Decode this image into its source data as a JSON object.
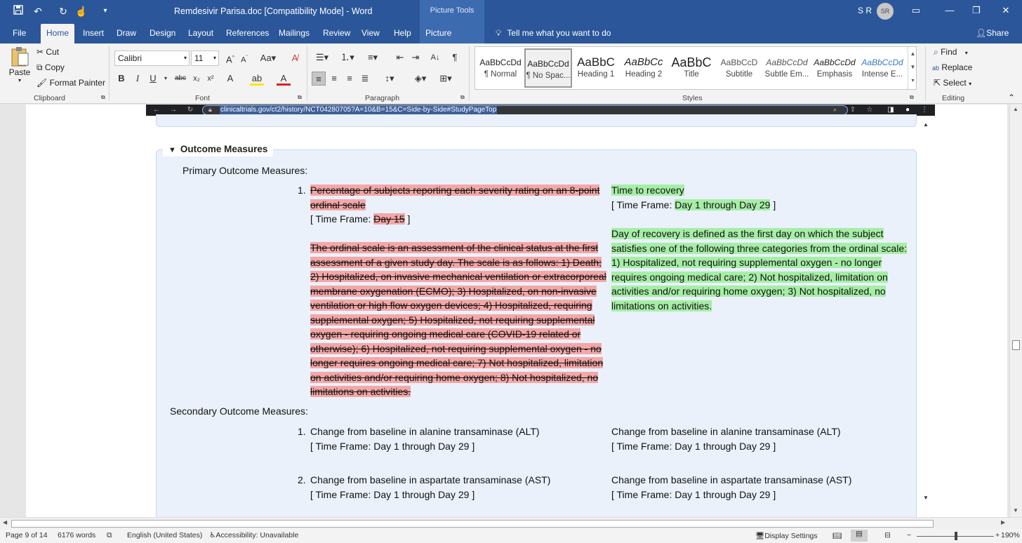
{
  "titlebar": {
    "doc_title": "Remdesivir Parisa.doc  [Compatibility Mode]  -  Word",
    "picture_tools": "Picture Tools",
    "user_initials": "S R",
    "avatar": "SR"
  },
  "tabs": [
    "File",
    "Home",
    "Insert",
    "Draw",
    "Design",
    "Layout",
    "References",
    "Mailings",
    "Review",
    "View",
    "Help",
    "Picture Format"
  ],
  "tell_me": "Tell me what you want to do",
  "share": "Share",
  "clipboard": {
    "paste": "Paste",
    "cut": "Cut",
    "copy": "Copy",
    "format_painter": "Format Painter",
    "label": "Clipboard"
  },
  "font": {
    "name": "Calibri",
    "size": "11",
    "label": "Font"
  },
  "paragraph": {
    "label": "Paragraph"
  },
  "styles": {
    "label": "Styles",
    "items": [
      {
        "preview": "AaBbCcDd",
        "name": "¶ Normal"
      },
      {
        "preview": "AaBbCcDd",
        "name": "¶ No Spac..."
      },
      {
        "preview": "AaBbC",
        "name": "Heading 1"
      },
      {
        "preview": "AaBbCc",
        "name": "Heading 2"
      },
      {
        "preview": "AaBbC",
        "name": "Title"
      },
      {
        "preview": "AaBbCcD",
        "name": "Subtitle"
      },
      {
        "preview": "AaBbCcDd",
        "name": "Subtle Em..."
      },
      {
        "preview": "AaBbCcDd",
        "name": "Emphasis"
      },
      {
        "preview": "AaBbCcDd",
        "name": "Intense E..."
      }
    ]
  },
  "editing": {
    "find": "Find",
    "replace": "Replace",
    "select": "Select",
    "label": "Editing"
  },
  "browser": {
    "url": "clinicaltrials.gov/ct2/history/NCT04280705?A=10&B=15&C=Side-by-Side#StudyPageTop"
  },
  "document": {
    "section_title": "Outcome Measures",
    "primary_label": "Primary Outcome Measures:",
    "secondary_label": "Secondary Outcome Measures:",
    "primary_old": {
      "num": "1.",
      "title_line1": "Percentage of subjects reporting each severity rating on an 8-point",
      "title_line2": "ordinal scale",
      "timeframe_prefix": "[ Time Frame: ",
      "timeframe_value": "Day 15",
      "timeframe_suffix": " ]",
      "desc_lines": [
        "The ordinal scale is an assessment of the clinical status at the first",
        "assessment of a given study day. The scale is as follows: 1) Death;",
        "2) Hospitalized, on invasive mechanical ventilation or extracorporeal",
        "membrane oxygenation (ECMO); 3) Hospitalized, on non-invasive",
        "ventilation or high flow oxygen devices; 4) Hospitalized, requiring",
        "supplemental oxygen; 5) Hospitalized, not requiring supplemental",
        "oxygen - requiring ongoing medical care (COVID-19 related or",
        "otherwise); 6) Hospitalized, not requiring supplemental oxygen - no",
        "longer requires ongoing medical care; 7) Not hospitalized, limitation",
        "on activities and/or requiring home oxygen; 8) Not hospitalized, no",
        "limitations on activities."
      ]
    },
    "primary_new": {
      "title": "Time to recovery",
      "timeframe_prefix": "[ Time Frame: ",
      "timeframe_value": "Day 1 through Day 29",
      "timeframe_suffix": " ]",
      "desc_lines": [
        "Day of recovery is defined as the first day on which the subject",
        "satisfies one of the following three categories from the ordinal scale:",
        "1) Hospitalized, not requiring supplemental oxygen - no longer",
        "requires ongoing medical care; 2) Not hospitalized, limitation on",
        "activities and/or requiring home oxygen; 3) Not hospitalized, no",
        "limitations on activities."
      ]
    },
    "secondary": [
      {
        "num": "1.",
        "old_title": "Change from baseline in alanine transaminase (ALT)",
        "old_timeframe": "[ Time Frame: Day 1 through Day 29 ]",
        "new_title": "Change from baseline in alanine transaminase (ALT)",
        "new_timeframe": "[ Time Frame: Day 1 through Day 29 ]"
      },
      {
        "num": "2.",
        "old_title": "Change from baseline in aspartate transaminase (AST)",
        "old_timeframe": "[ Time Frame: Day 1 through Day 29 ]",
        "new_title": "Change from baseline in aspartate transaminase (AST)",
        "new_timeframe": "[ Time Frame: Day 1 through Day 29 ]"
      }
    ]
  },
  "statusbar": {
    "page": "Page 9 of 14",
    "words": "6176 words",
    "language": "English (United States)",
    "accessibility": "Accessibility: Unavailable",
    "display_settings": "Display Settings",
    "zoom": "190%"
  },
  "colors": {
    "word_blue": "#2b579a",
    "deleted_highlight": "#f4a7a7",
    "added_highlight": "#a6eea6",
    "box_background": "#eaf1fb"
  }
}
